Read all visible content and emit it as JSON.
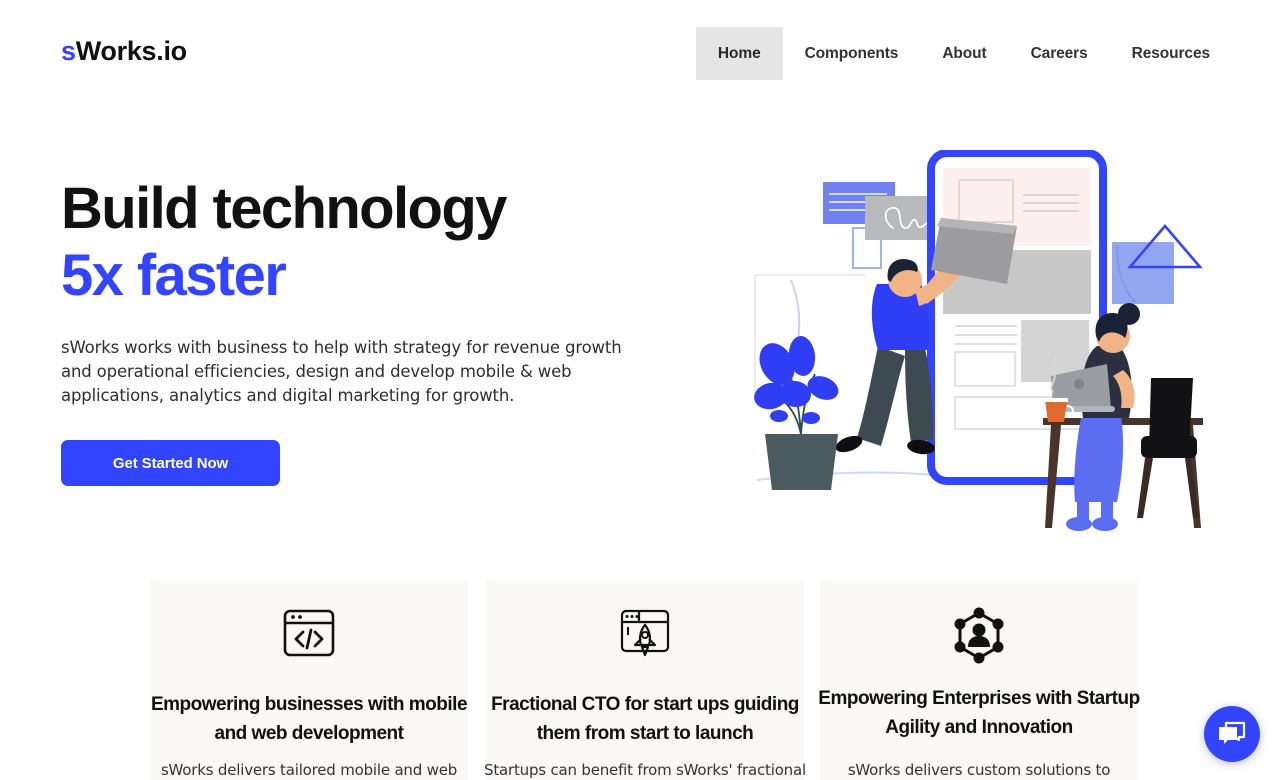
{
  "brand": {
    "logo_accent": "s",
    "logo_rest": "Works.io",
    "accent_color": "#3344ff"
  },
  "nav": {
    "items": [
      {
        "label": "Home",
        "active": true
      },
      {
        "label": "Components",
        "active": false
      },
      {
        "label": "About",
        "active": false
      },
      {
        "label": "Careers",
        "active": false
      },
      {
        "label": "Resources",
        "active": false
      }
    ]
  },
  "hero": {
    "headline_line1": "Build technology",
    "headline_line2": "5x faster",
    "subcopy": "sWorks works with business  to help with strategy for revenue growth and operational efficiencies, design and develop mobile & web applications, analytics and digital marketing for growth.",
    "cta_label": "Get Started Now",
    "illustration_name": "team-building-app-illustration"
  },
  "cards": [
    {
      "icon": "code-window-icon",
      "title": "Empowering businesses with mobile and web development",
      "body": "sWorks delivers tailored mobile and web"
    },
    {
      "icon": "rocket-window-icon",
      "title": "Fractional CTO for start ups guiding them from start to launch",
      "body": "Startups can benefit from sWorks' fractional"
    },
    {
      "icon": "network-person-icon",
      "title": "Empowering Enterprises with Startup Agility and Innovation",
      "body": "sWorks delivers custom solutions to"
    }
  ],
  "chat": {
    "icon": "chat-bubbles-icon",
    "color": "#3344ff"
  }
}
